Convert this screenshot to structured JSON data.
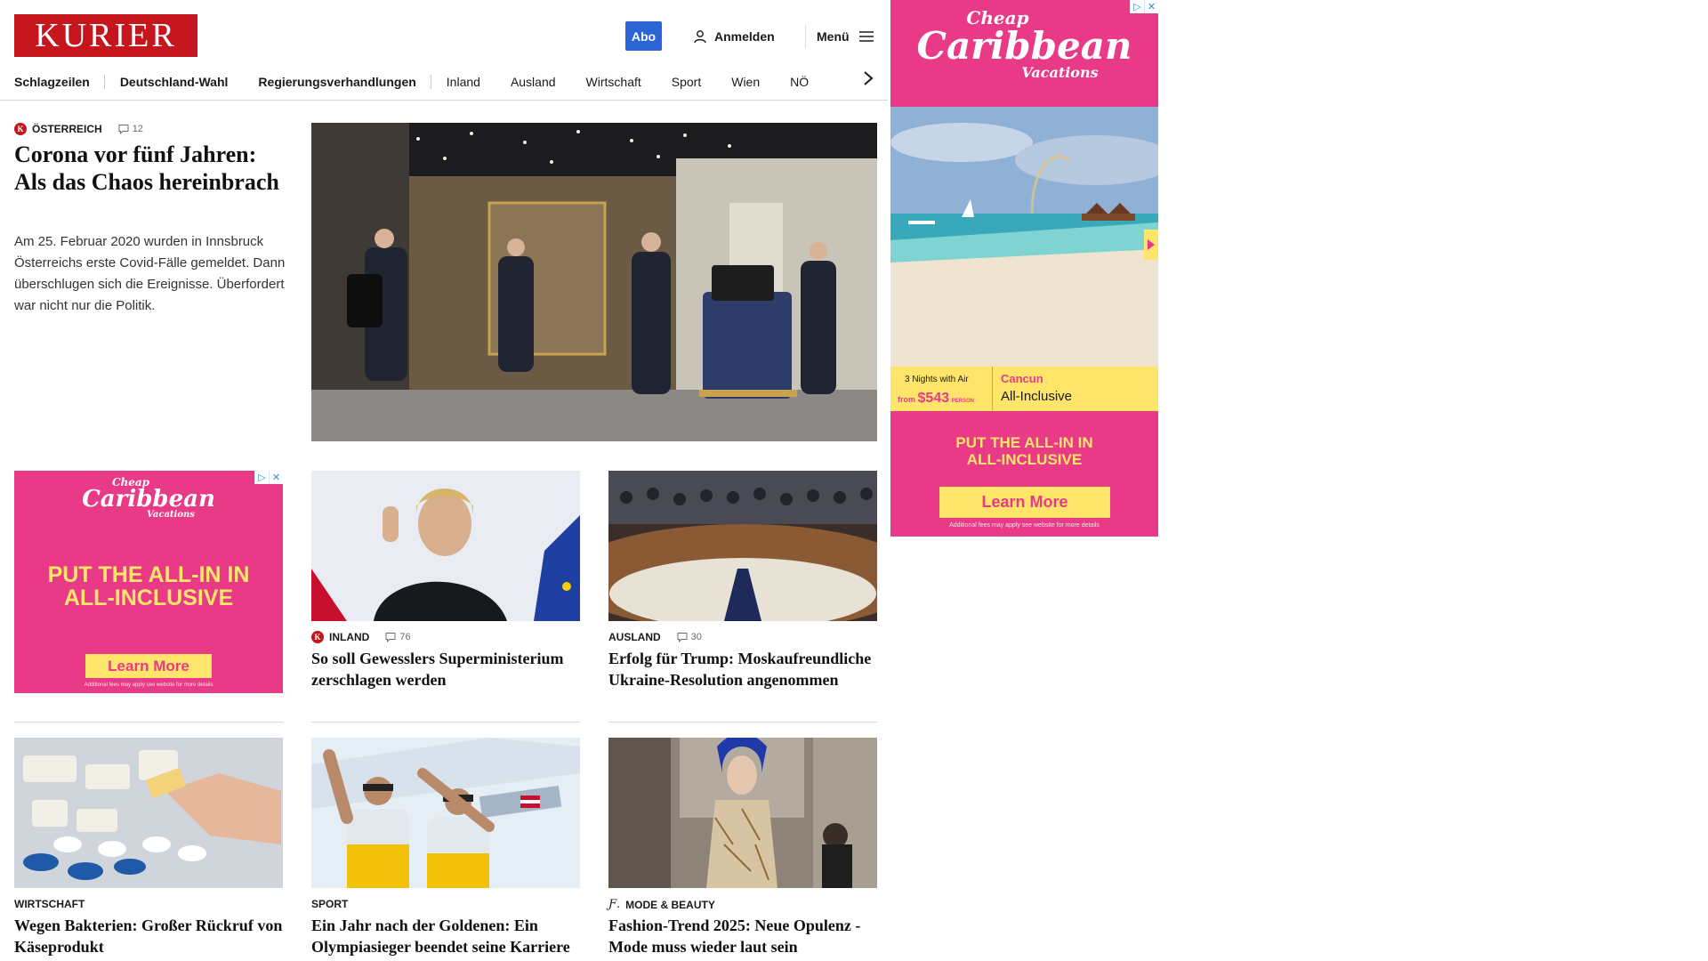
{
  "header": {
    "logo": "KURIER",
    "abo_label": "Abo",
    "login_label": "Anmelden",
    "menu_label": "Menü"
  },
  "nav": {
    "items": [
      "Schlagzeilen",
      "Deutschland-Wahl",
      "Regierungsverhandlungen",
      "Inland",
      "Ausland",
      "Wirtschaft",
      "Sport",
      "Wien",
      "NÖ"
    ]
  },
  "lead": {
    "category": "Österreich",
    "comments": "12",
    "title": "Corona vor fünf Jahren: Als das Chaos hereinbrach",
    "teaser": "Am 25. Februar 2020 wurden in Innsbruck Österreichs erste Covid-Fälle gemeldet. Dann überschlugen sich die Ereignisse. Überfordert war nicht nur die Politik."
  },
  "cards": [
    {
      "category": "Inland",
      "comments": "76",
      "title": "So soll Gewesslers Superministerium zerschlagen werden"
    },
    {
      "category": "Ausland",
      "comments": "30",
      "title": "Erfolg für Trump: Moskaufreundliche Ukraine-Resolution angenommen"
    },
    {
      "category": "Wirtschaft",
      "title": "Wegen Bakterien: Großer Rückruf von Käseprodukt"
    },
    {
      "category": "Sport",
      "title": "Ein Jahr nach der Goldenen: Ein Olympiasieger beendet seine Karriere"
    },
    {
      "category": "Mode & Beauty",
      "title": "Fashion-Trend 2025: Neue Opulenz - Mode muss wieder laut sein"
    }
  ],
  "ad_inline": {
    "logo_top": "Cheap",
    "logo_main": "Caribbean",
    "logo_bottom": "Vacations",
    "headline_1": "PUT THE ALL-IN IN",
    "headline_2": "ALL-INCLUSIVE",
    "button": "Learn More",
    "fine_print": "Additional fees may apply see website for more details"
  },
  "ad_side": {
    "logo_top": "Cheap",
    "logo_main": "Caribbean",
    "logo_bottom": "Vacations",
    "nights": "3 Nights with Air",
    "from": "from",
    "price": "$543",
    "per": "PERSON",
    "destination": "Cancun",
    "package": "All-Inclusive",
    "headline_1": "PUT THE ALL-IN IN",
    "headline_2": "ALL-INCLUSIVE",
    "button": "Learn More",
    "fine_print": "Additional fees may apply see website for more details"
  },
  "colors": {
    "brand": "#c4161c",
    "abo": "#2c64d6",
    "ad_pink": "#e83a86",
    "ad_yellow": "#ffe66b"
  }
}
